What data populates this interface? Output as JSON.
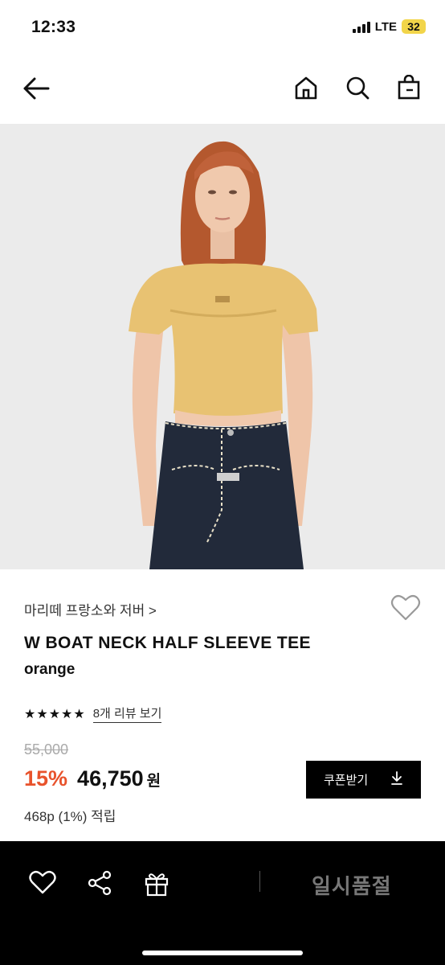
{
  "status_bar": {
    "time": "12:33",
    "network": "LTE",
    "battery": "32",
    "battery_color": "#f2d54a"
  },
  "nav": {
    "icons": [
      "back-arrow-icon",
      "home-icon",
      "search-icon",
      "shopping-bag-icon"
    ]
  },
  "product": {
    "brand": "마리떼 프랑소와 저버 >",
    "name": "W BOAT NECK HALF SLEEVE TEE",
    "color": "orange",
    "rating_stars": 5,
    "review_link": "8개 리뷰 보기",
    "original_price": "55,000",
    "discount": "15%",
    "sale_price": "46,750",
    "currency": "원",
    "coupon_label": "쿠폰받기",
    "points": "468p (1%) 적립",
    "accent_color": "#e8532c"
  },
  "bottom_bar": {
    "status": "일시품절",
    "icons": [
      "heart-icon",
      "share-icon",
      "gift-icon"
    ]
  }
}
